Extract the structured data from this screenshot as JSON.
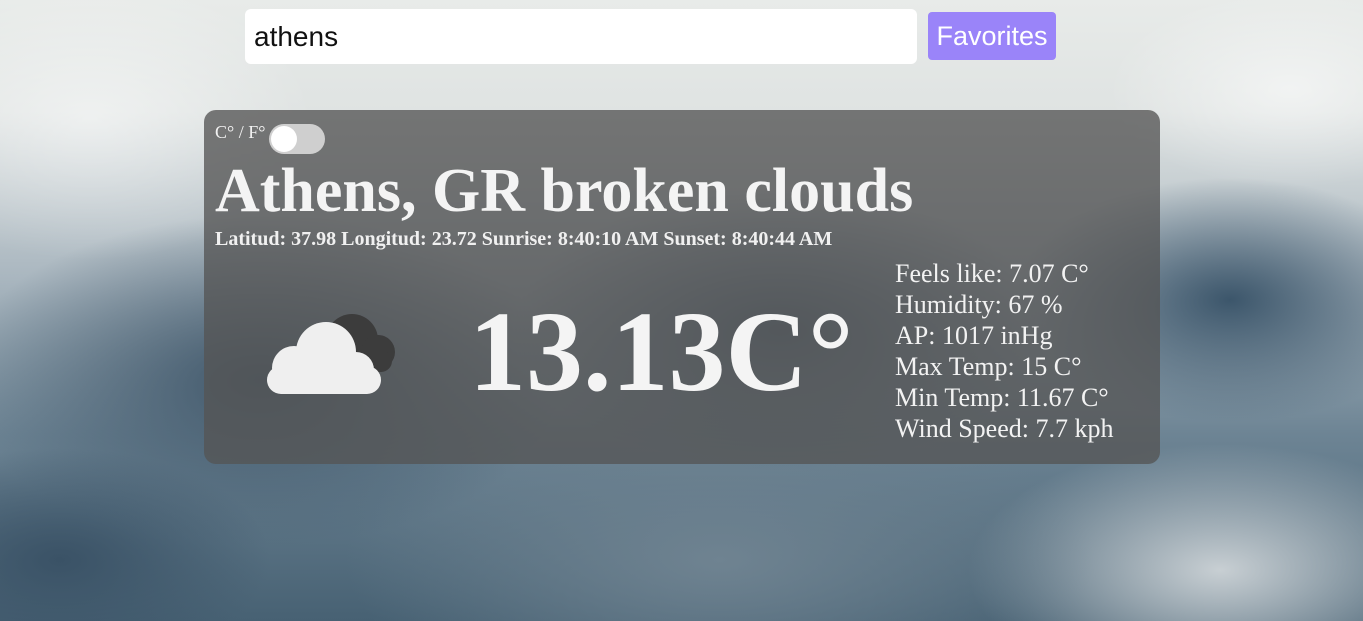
{
  "search": {
    "value": "athens"
  },
  "favorites_label": "Favorites",
  "card": {
    "unit_label": "C° / F°",
    "unit_toggle_on": false,
    "location": "Athens, GR",
    "description": "broken clouds",
    "meta_line": "Latitud: 37.98 Longitud: 23.72 Sunrise: 8:40:10 AM Sunset: 8:40:44 AM",
    "icon": "broken-clouds-icon",
    "temperature": "13.13C°",
    "details": {
      "feels_like": "Feels like: 7.07 C°",
      "humidity": "Humidity: 67 %",
      "pressure": "AP: 1017 inHg",
      "max_temp": "Max Temp: 15 C°",
      "min_temp": "Min Temp: 11.67 C°",
      "wind_speed": "Wind Speed: 7.7 kph"
    }
  },
  "colors": {
    "accent": "#9a84f9",
    "card_bg": "#555555",
    "text": "#ffffff"
  }
}
